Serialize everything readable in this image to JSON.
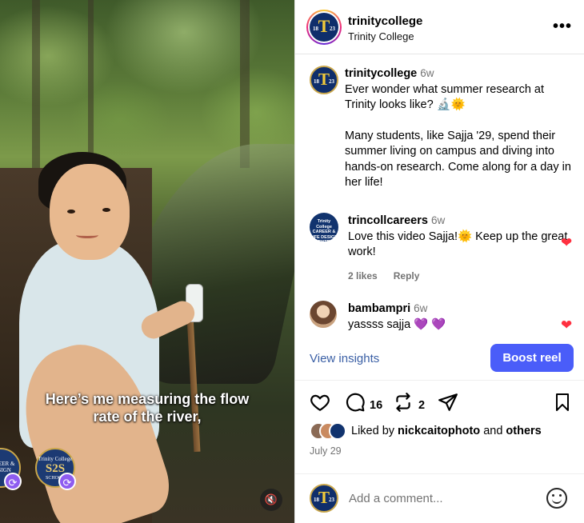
{
  "header": {
    "username": "trinitycollege",
    "subtitle": "Trinity College",
    "more_label": "•••"
  },
  "avatar": {
    "letter": "T",
    "year_left": "18",
    "year_right": "23"
  },
  "video": {
    "caption_line1": "Here’s me measuring the flow",
    "caption_line2": "rate of the river,",
    "collab_badges": [
      {
        "top": "Trinity College",
        "main": "S2S",
        "sub": "SCHOOL"
      },
      {
        "top": "",
        "main": "CAREER & DESIGN",
        "sub": ""
      }
    ]
  },
  "caption": {
    "username": "trinitycollege",
    "age": "6w",
    "line1": "Ever wonder what summer research at Trinity looks like? 🔬🌞",
    "line2": "Many students, like Sajja '29, spend their summer living on campus and diving into hands-on research. Come along for a day in her life!"
  },
  "comments": [
    {
      "username": "trincollcareers",
      "age": "6w",
      "text": "Love this video Sajja!🌞  Keep up the great work!",
      "likes": "2 likes",
      "reply": "Reply",
      "avatar_text": "Trinity College CAREER & LIFE DESIGN CENTER"
    },
    {
      "username": "bambampri",
      "age": "6w",
      "text": "yassss sajja 💜 💜"
    }
  ],
  "actions": {
    "view_insights": "View insights",
    "boost_label": "Boost reel",
    "comment_count": "16",
    "repost_count": "2"
  },
  "likes": {
    "prefix": "Liked by ",
    "user": "nickcaitophoto",
    "middle": " and ",
    "others": "others"
  },
  "date": "July 29",
  "add_comment": {
    "placeholder": "Add a comment..."
  },
  "colors": {
    "accent": "#4a5df9",
    "heart": "#ff3040",
    "brand_navy": "#0f2e6b",
    "brand_gold": "#f0c93a"
  }
}
